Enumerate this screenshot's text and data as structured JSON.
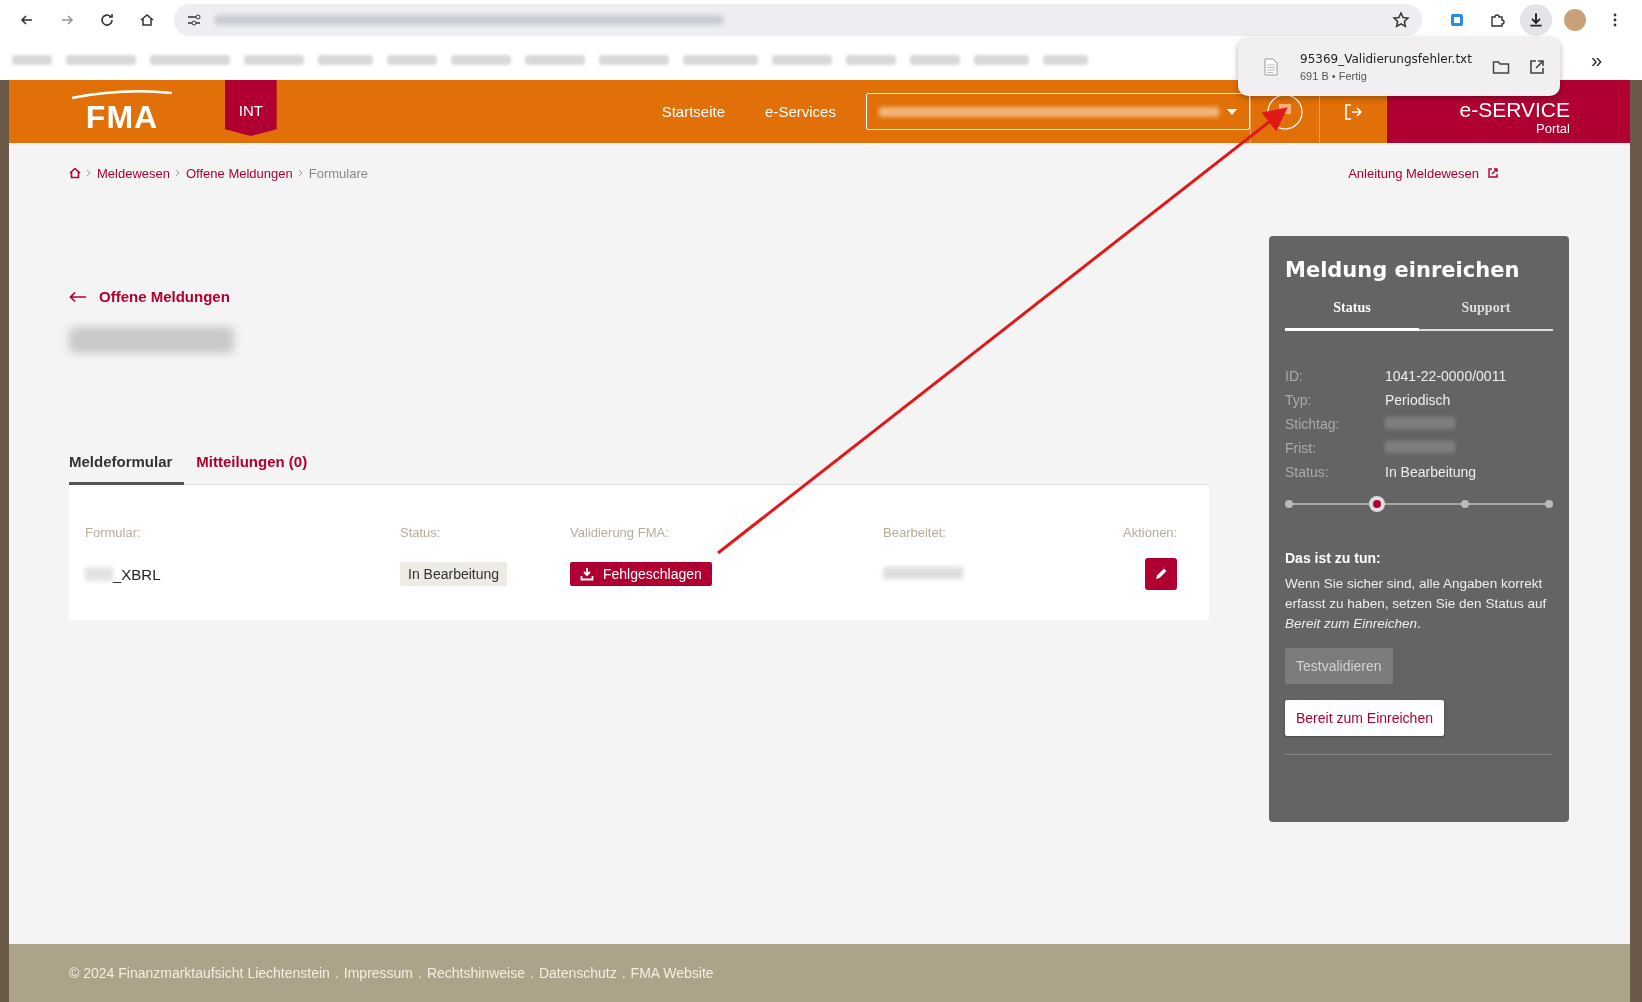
{
  "browser": {
    "bookmarks_more": "»"
  },
  "download": {
    "filename": "95369_Validierungsfehler.txt",
    "meta": "691 B • Fertig"
  },
  "header": {
    "logo": "FMA",
    "environment": "INT",
    "nav": [
      "Startseite",
      "e-Services"
    ],
    "portal_title": "e-SERVICE",
    "portal_subtitle": "Portal"
  },
  "breadcrumbs": [
    {
      "label": "Meldewesen",
      "link": true
    },
    {
      "label": "Offene Meldungen",
      "link": true
    },
    {
      "label": "Formulare",
      "link": false
    }
  ],
  "help_link": "Anleitung Meldewesen",
  "back_link": "Offene Meldungen",
  "tabs": [
    {
      "label": "Meldeformular",
      "selected": true
    },
    {
      "label": "Mitteilungen (0)",
      "selected": false
    }
  ],
  "table": {
    "columns": [
      "Formular:",
      "Status:",
      "Validierung FMA:",
      "Bearbeitet:",
      "Aktionen:"
    ],
    "rows": [
      {
        "formular": "_XBRL",
        "status": "In Bearbeitung",
        "validation": "Fehlgeschlagen"
      }
    ]
  },
  "sidebar": {
    "title": "Meldung einreichen",
    "tabs": [
      {
        "label": "Status",
        "selected": true
      },
      {
        "label": "Support",
        "selected": false
      }
    ],
    "fields": [
      {
        "label": "ID:",
        "value": "1041-22-0000/0011"
      },
      {
        "label": "Typ:",
        "value": "Periodisch"
      },
      {
        "label": "Stichtag:"
      },
      {
        "label": "Frist:"
      },
      {
        "label": "Status:",
        "value": "In Bearbeitung"
      }
    ],
    "steps": [
      {
        "selected": false
      },
      {
        "selected": true
      },
      {
        "selected": false
      },
      {
        "selected": false
      }
    ],
    "todo_title": "Das ist zu tun:",
    "todo_text": "Wenn Sie sicher sind, alle Angaben korrekt erfasst zu haben, setzen Sie den Status auf *Bereit zum Einreichen*.",
    "buttons": [
      {
        "label": "Testvalidieren",
        "disabled": true
      },
      {
        "label": "Bereit zum Einreichen",
        "disabled": false
      }
    ]
  },
  "footer": {
    "separator": ".",
    "items": [
      "© 2024 Finanzmarktaufsicht Liechtenstein",
      "Impressum",
      "Rechtshinweise",
      "Datenschutz",
      "FMA Website"
    ]
  }
}
